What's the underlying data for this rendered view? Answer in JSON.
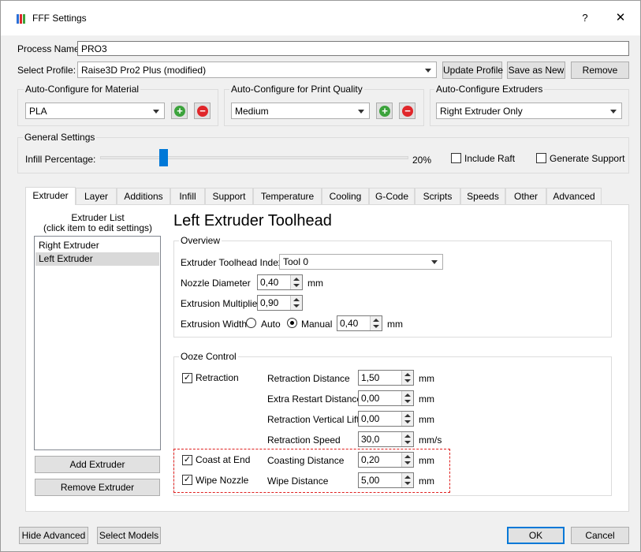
{
  "window": {
    "title": "FFF Settings",
    "help_label": "?",
    "close_label": "✕"
  },
  "process": {
    "label": "Process Name:",
    "value": "PRO3"
  },
  "profile": {
    "label": "Select Profile:",
    "selected": "Raise3D Pro2 Plus (modified)",
    "update_label": "Update Profile",
    "save_new_label": "Save as New",
    "remove_label": "Remove"
  },
  "auto_material": {
    "title": "Auto-Configure for Material",
    "selected": "PLA"
  },
  "auto_quality": {
    "title": "Auto-Configure for Print Quality",
    "selected": "Medium"
  },
  "auto_extruders": {
    "title": "Auto-Configure Extruders",
    "selected": "Right Extruder Only"
  },
  "general": {
    "title": "General Settings",
    "infill_label": "Infill Percentage:",
    "infill_value": "20%",
    "infill_fraction": 0.2,
    "include_raft_label": "Include Raft",
    "include_raft_checked": false,
    "generate_support_label": "Generate Support",
    "generate_support_checked": false
  },
  "tabs": [
    "Extruder",
    "Layer",
    "Additions",
    "Infill",
    "Support",
    "Temperature",
    "Cooling",
    "G-Code",
    "Scripts",
    "Speeds",
    "Other",
    "Advanced"
  ],
  "active_tab": "Extruder",
  "extruder_list": {
    "title_line1": "Extruder List",
    "title_line2": "(click item to edit settings)",
    "items": [
      "Right Extruder",
      "Left Extruder"
    ],
    "selected": "Left Extruder",
    "add_label": "Add Extruder",
    "remove_label": "Remove Extruder"
  },
  "toolhead": {
    "heading": "Left Extruder Toolhead",
    "overview_title": "Overview",
    "index_label": "Extruder Toolhead Index",
    "index_value": "Tool 0",
    "nozzle_label": "Nozzle Diameter",
    "nozzle_value": "0,40",
    "nozzle_unit": "mm",
    "multiplier_label": "Extrusion Multiplier",
    "multiplier_value": "0,90",
    "width_label": "Extrusion Width",
    "auto_label": "Auto",
    "manual_label": "Manual",
    "width_value": "0,40",
    "width_unit": "mm"
  },
  "ooze": {
    "title": "Ooze Control",
    "retraction_label": "Retraction",
    "retraction_checked": true,
    "retraction_distance_label": "Retraction Distance",
    "retraction_distance_value": "1,50",
    "extra_restart_label": "Extra Restart Distance",
    "extra_restart_value": "0,00",
    "vertical_lift_label": "Retraction Vertical Lift",
    "vertical_lift_value": "0,00",
    "speed_label": "Retraction Speed",
    "speed_value": "30,0",
    "speed_unit": "mm/s",
    "coast_label": "Coast at End",
    "coast_checked": true,
    "coasting_distance_label": "Coasting Distance",
    "coasting_distance_value": "0,20",
    "wipe_label": "Wipe Nozzle",
    "wipe_checked": true,
    "wipe_distance_label": "Wipe Distance",
    "wipe_distance_value": "5,00",
    "mm": "mm"
  },
  "footer": {
    "hide_advanced_label": "Hide Advanced",
    "select_models_label": "Select Models",
    "ok_label": "OK",
    "cancel_label": "Cancel"
  },
  "colors": {
    "accent": "#0078d7",
    "highlight": "#e0201f",
    "add": "#3ca33c",
    "remove": "#e0262a"
  }
}
